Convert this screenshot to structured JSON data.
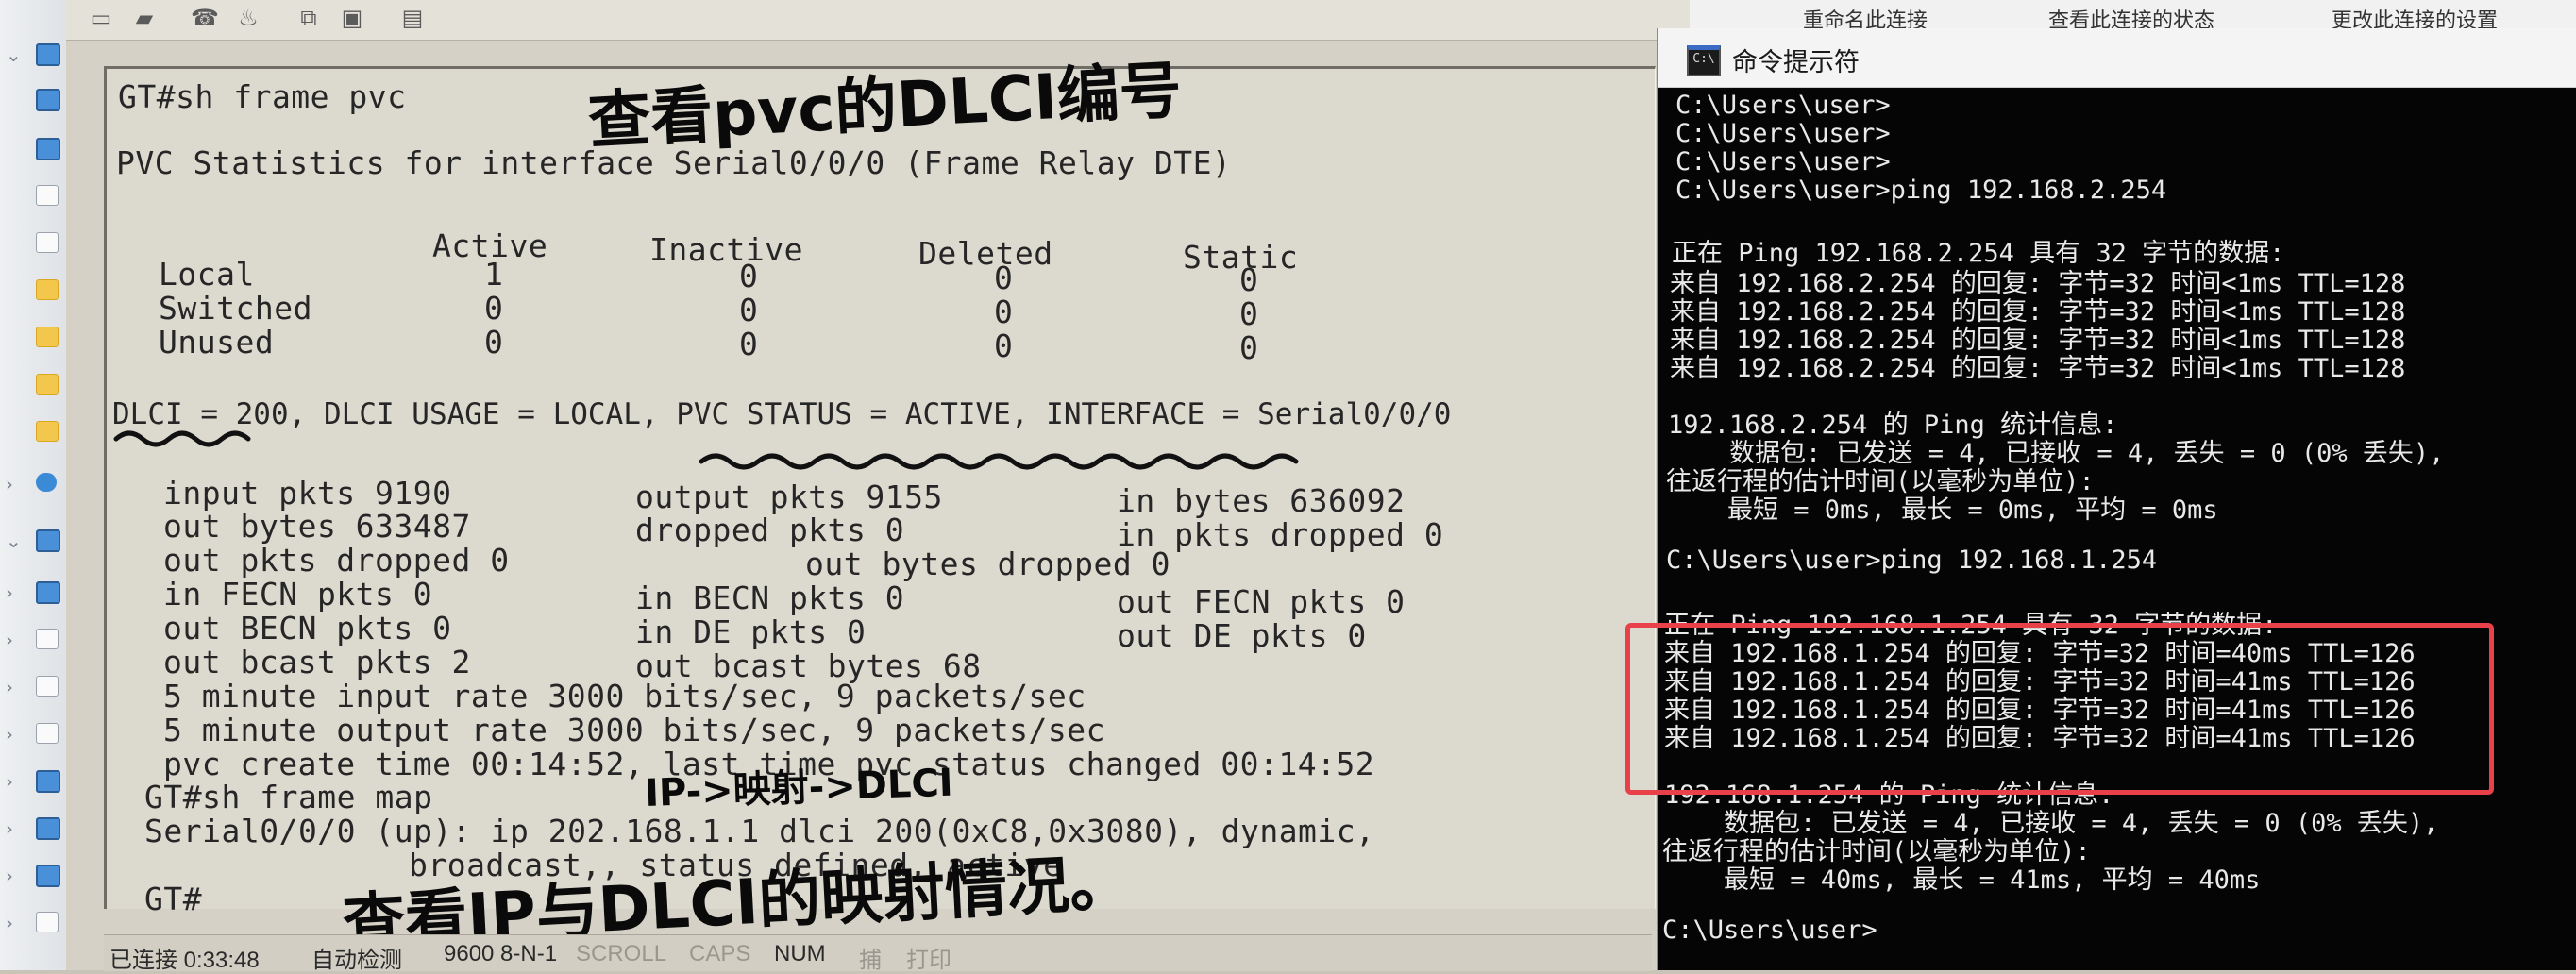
{
  "terminal": {
    "toolbar_icons": [
      "new-session-icon",
      "open-icon",
      "connect-icon",
      "properties-icon",
      "copy-icon",
      "paste-icon",
      "print-icon"
    ],
    "lines": {
      "l1": "GT#sh frame pvc",
      "l2": "PVC Statistics for interface Serial0/0/0 (Frame Relay DTE)",
      "hdr_active": "Active",
      "hdr_inactive": "Inactive",
      "hdr_deleted": "Deleted",
      "hdr_static": "Static",
      "row_local": "Local",
      "row_switched": "Switched",
      "row_unused": "Unused",
      "local_vals": [
        "1",
        "0",
        "0",
        "0"
      ],
      "switched_vals": [
        "0",
        "0",
        "0",
        "0"
      ],
      "unused_vals": [
        "0",
        "0",
        "0",
        "0"
      ],
      "dlci": "DLCI = 200, DLCI USAGE = LOCAL, PVC STATUS = ACTIVE, INTERFACE = Serial0/0/0",
      "s1a": "input pkts 9190",
      "s1b": "output pkts 9155",
      "s1c": "in bytes 636092",
      "s2a": "out bytes 633487",
      "s2b": "dropped pkts 0",
      "s2c": "in pkts dropped 0",
      "s3a": "out pkts dropped 0",
      "s3b": "out bytes dropped 0",
      "s4a": "in FECN pkts 0",
      "s4b": "in BECN pkts 0",
      "s4c": "out FECN pkts 0",
      "s5a": "out BECN pkts 0",
      "s5b": "in DE pkts 0",
      "s5c": "out DE pkts 0",
      "s6a": "out bcast pkts 2",
      "s6b": "out bcast bytes 68",
      "r1": "5 minute input rate 3000 bits/sec, 9 packets/sec",
      "r2": "5 minute output rate 3000 bits/sec, 9 packets/sec",
      "r3": "pvc create time 00:14:52, last time pvc status changed 00:14:52",
      "m1": "GT#sh frame map",
      "m2": "Serial0/0/0 (up): ip 202.168.1.1 dlci 200(0xC8,0x3080), dynamic,",
      "m3": "broadcast,, status defined, active",
      "m4": "GT#"
    },
    "annotations": {
      "top": "查看pvc的DLCI编号",
      "middle": "IP->映射->DLCI",
      "bottom": "查看IP与DLCI的映射情况。"
    },
    "status_bar": {
      "connected": "已连接 0:33:48",
      "mode": "自动检测",
      "port": "9600 8-N-1",
      "scroll": "SCROLL",
      "caps": "CAPS",
      "num": "NUM",
      "capture": "捕",
      "print": "打印"
    }
  },
  "background_window": {
    "links": [
      "重命名此连接",
      "查看此连接的状态",
      "更改此连接的设置"
    ]
  },
  "cmd": {
    "title": "命令提示符",
    "icon_text": "C:\\",
    "lines": [
      "C:\\Users\\user>",
      "C:\\Users\\user>",
      "C:\\Users\\user>",
      "C:\\Users\\user>ping 192.168.2.254",
      "",
      "正在 Ping 192.168.2.254 具有 32 字节的数据:",
      "来自 192.168.2.254 的回复: 字节=32 时间<1ms TTL=128",
      "来自 192.168.2.254 的回复: 字节=32 时间<1ms TTL=128",
      "来自 192.168.2.254 的回复: 字节=32 时间<1ms TTL=128",
      "来自 192.168.2.254 的回复: 字节=32 时间<1ms TTL=128",
      "",
      "192.168.2.254 的 Ping 统计信息:",
      "    数据包: 已发送 = 4, 已接收 = 4, 丢失 = 0 (0% 丢失),",
      "往返行程的估计时间(以毫秒为单位):",
      "    最短 = 0ms, 最长 = 0ms, 平均 = 0ms",
      "",
      "C:\\Users\\user>ping 192.168.1.254",
      "",
      "正在 Ping 192.168.1.254 具有 32 字节的数据:",
      "来自 192.168.1.254 的回复: 字节=32 时间=40ms TTL=126",
      "来自 192.168.1.254 的回复: 字节=32 时间=41ms TTL=126",
      "来自 192.168.1.254 的回复: 字节=32 时间=41ms TTL=126",
      "来自 192.168.1.254 的回复: 字节=32 时间=41ms TTL=126",
      "",
      "192.168.1.254 的 Ping 统计信息:",
      "    数据包: 已发送 = 4, 已接收 = 4, 丢失 = 0 (0% 丢失),",
      "往返行程的估计时间(以毫秒为单位):",
      "    最短 = 40ms, 最长 = 41ms, 平均 = 40ms",
      "",
      "C:\\Users\\user>"
    ]
  },
  "colors": {
    "highlight": "#e8414a",
    "cmd_bg": "#050505",
    "cmd_text": "#e9e9e9",
    "terminal_bg": "#dcd9cf"
  }
}
